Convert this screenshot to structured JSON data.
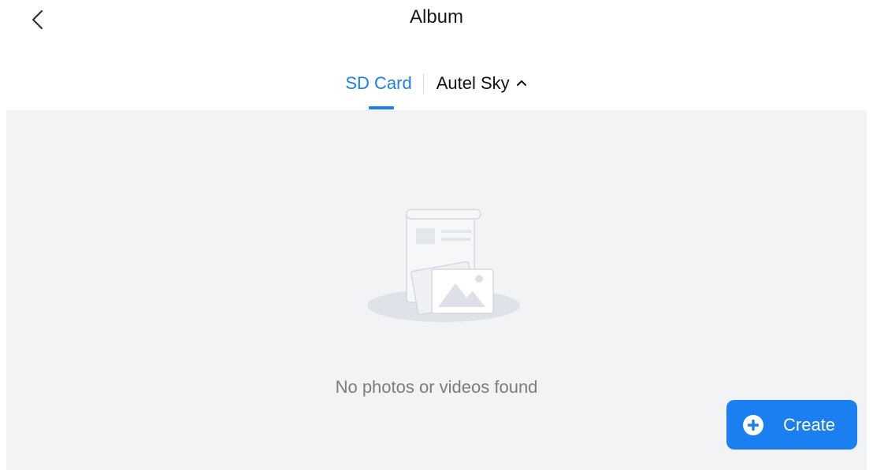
{
  "header": {
    "back_icon": "chevron-left-icon",
    "title": "Album"
  },
  "tabs": [
    {
      "label": "SD Card",
      "active": true
    },
    {
      "label": "Autel Sky",
      "icon": "chevron-up-icon",
      "active": false
    }
  ],
  "empty_state": {
    "illustration": "empty-album-illustration",
    "message": "No photos or videos found"
  },
  "actions": {
    "create_label": "Create",
    "create_icon": "plus-circle-icon"
  },
  "colors": {
    "accent": "#1a7ff0",
    "content_bg": "#f2f3f5",
    "text_muted": "#7c7c7c"
  }
}
